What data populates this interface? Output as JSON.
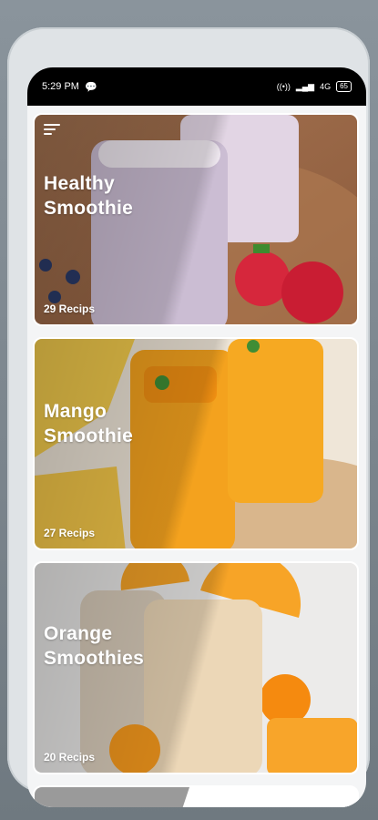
{
  "status_bar": {
    "time": "5:29 PM",
    "network": "4G",
    "battery": "65"
  },
  "cards": [
    {
      "title": "Healthy Smoothie",
      "count": "29 Recips",
      "accent": "#b7a6c2"
    },
    {
      "title": "Mango Smoothie",
      "count": "27 Recips",
      "accent": "#f1a21f"
    },
    {
      "title": "Orange Smoothies",
      "count": "20 Recips",
      "accent": "#d9c3a5"
    }
  ],
  "icons": {
    "menu": "menu-icon",
    "chat": "chat-icon",
    "signal": "signal-icon",
    "battery": "battery-icon"
  }
}
